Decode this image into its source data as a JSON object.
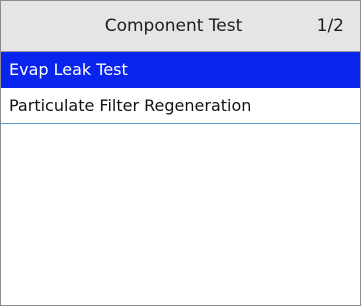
{
  "header": {
    "title": "Component Test",
    "page_indicator": "1/2"
  },
  "menu": {
    "selected_index": 0,
    "items": [
      {
        "label": "Evap Leak Test"
      },
      {
        "label": "Particulate Filter Regeneration"
      }
    ]
  },
  "colors": {
    "header_bg": "#e5e5e5",
    "selection_bg": "#0a24f0",
    "selection_text": "#ffffff",
    "row_divider": "#5d9fd3"
  }
}
